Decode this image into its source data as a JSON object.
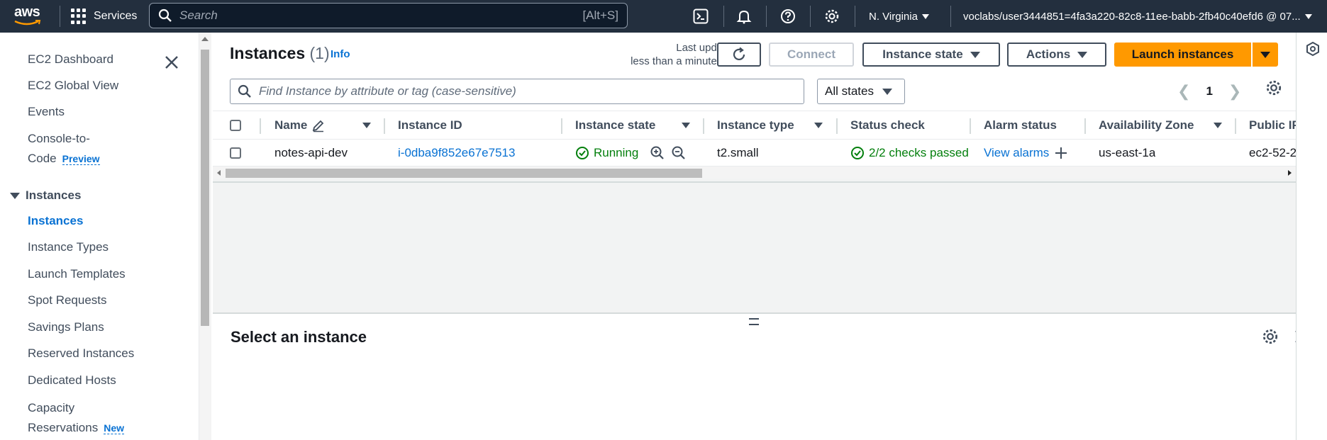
{
  "topnav": {
    "logo": "aws",
    "services_label": "Services",
    "search_placeholder": "Search",
    "search_shortcut": "[Alt+S]",
    "region": "N. Virginia",
    "account": "voclabs/user3444851=4fa3a220-82c8-11ee-babb-2fb40c40efd6 @ 07..."
  },
  "sidebar": {
    "items": [
      {
        "label": "EC2 Dashboard"
      },
      {
        "label": "EC2 Global View"
      },
      {
        "label": "Events"
      },
      {
        "label": "Console-to-",
        "label2": "Code",
        "badge": "Preview"
      }
    ],
    "section": "Instances",
    "section_items": [
      {
        "label": "Instances",
        "active": true
      },
      {
        "label": "Instance Types"
      },
      {
        "label": "Launch Templates"
      },
      {
        "label": "Spot Requests"
      },
      {
        "label": "Savings Plans"
      },
      {
        "label": "Reserved Instances"
      },
      {
        "label": "Dedicated Hosts"
      },
      {
        "label": "Capacity",
        "label2": "Reservations",
        "badge": "New"
      }
    ]
  },
  "header": {
    "title": "Instances",
    "count": "(1)",
    "info": "Info",
    "last_updated_label": "Last updated",
    "last_updated_value": "less than a minute ago",
    "connect": "Connect",
    "instance_state": "Instance state",
    "actions": "Actions",
    "launch": "Launch instances"
  },
  "filter": {
    "placeholder": "Find Instance by attribute or tag (case-sensitive)",
    "states": "All states",
    "page": "1"
  },
  "table": {
    "columns": [
      "Name",
      "Instance ID",
      "Instance state",
      "Instance type",
      "Status check",
      "Alarm status",
      "Availability Zone",
      "Public IP"
    ],
    "rows": [
      {
        "name": "notes-api-dev",
        "instance_id": "i-0dba9f852e67e7513",
        "state": "Running",
        "type": "t2.small",
        "status_check": "2/2 checks passed",
        "alarm": "View alarms",
        "az": "us-east-1a",
        "public_dns": "ec2-52-2"
      }
    ]
  },
  "split": {
    "title": "Select an instance"
  },
  "colors": {
    "nav_bg": "#232f3e",
    "primary": "#ff9900",
    "link": "#0972d3",
    "success": "#037f0c"
  }
}
